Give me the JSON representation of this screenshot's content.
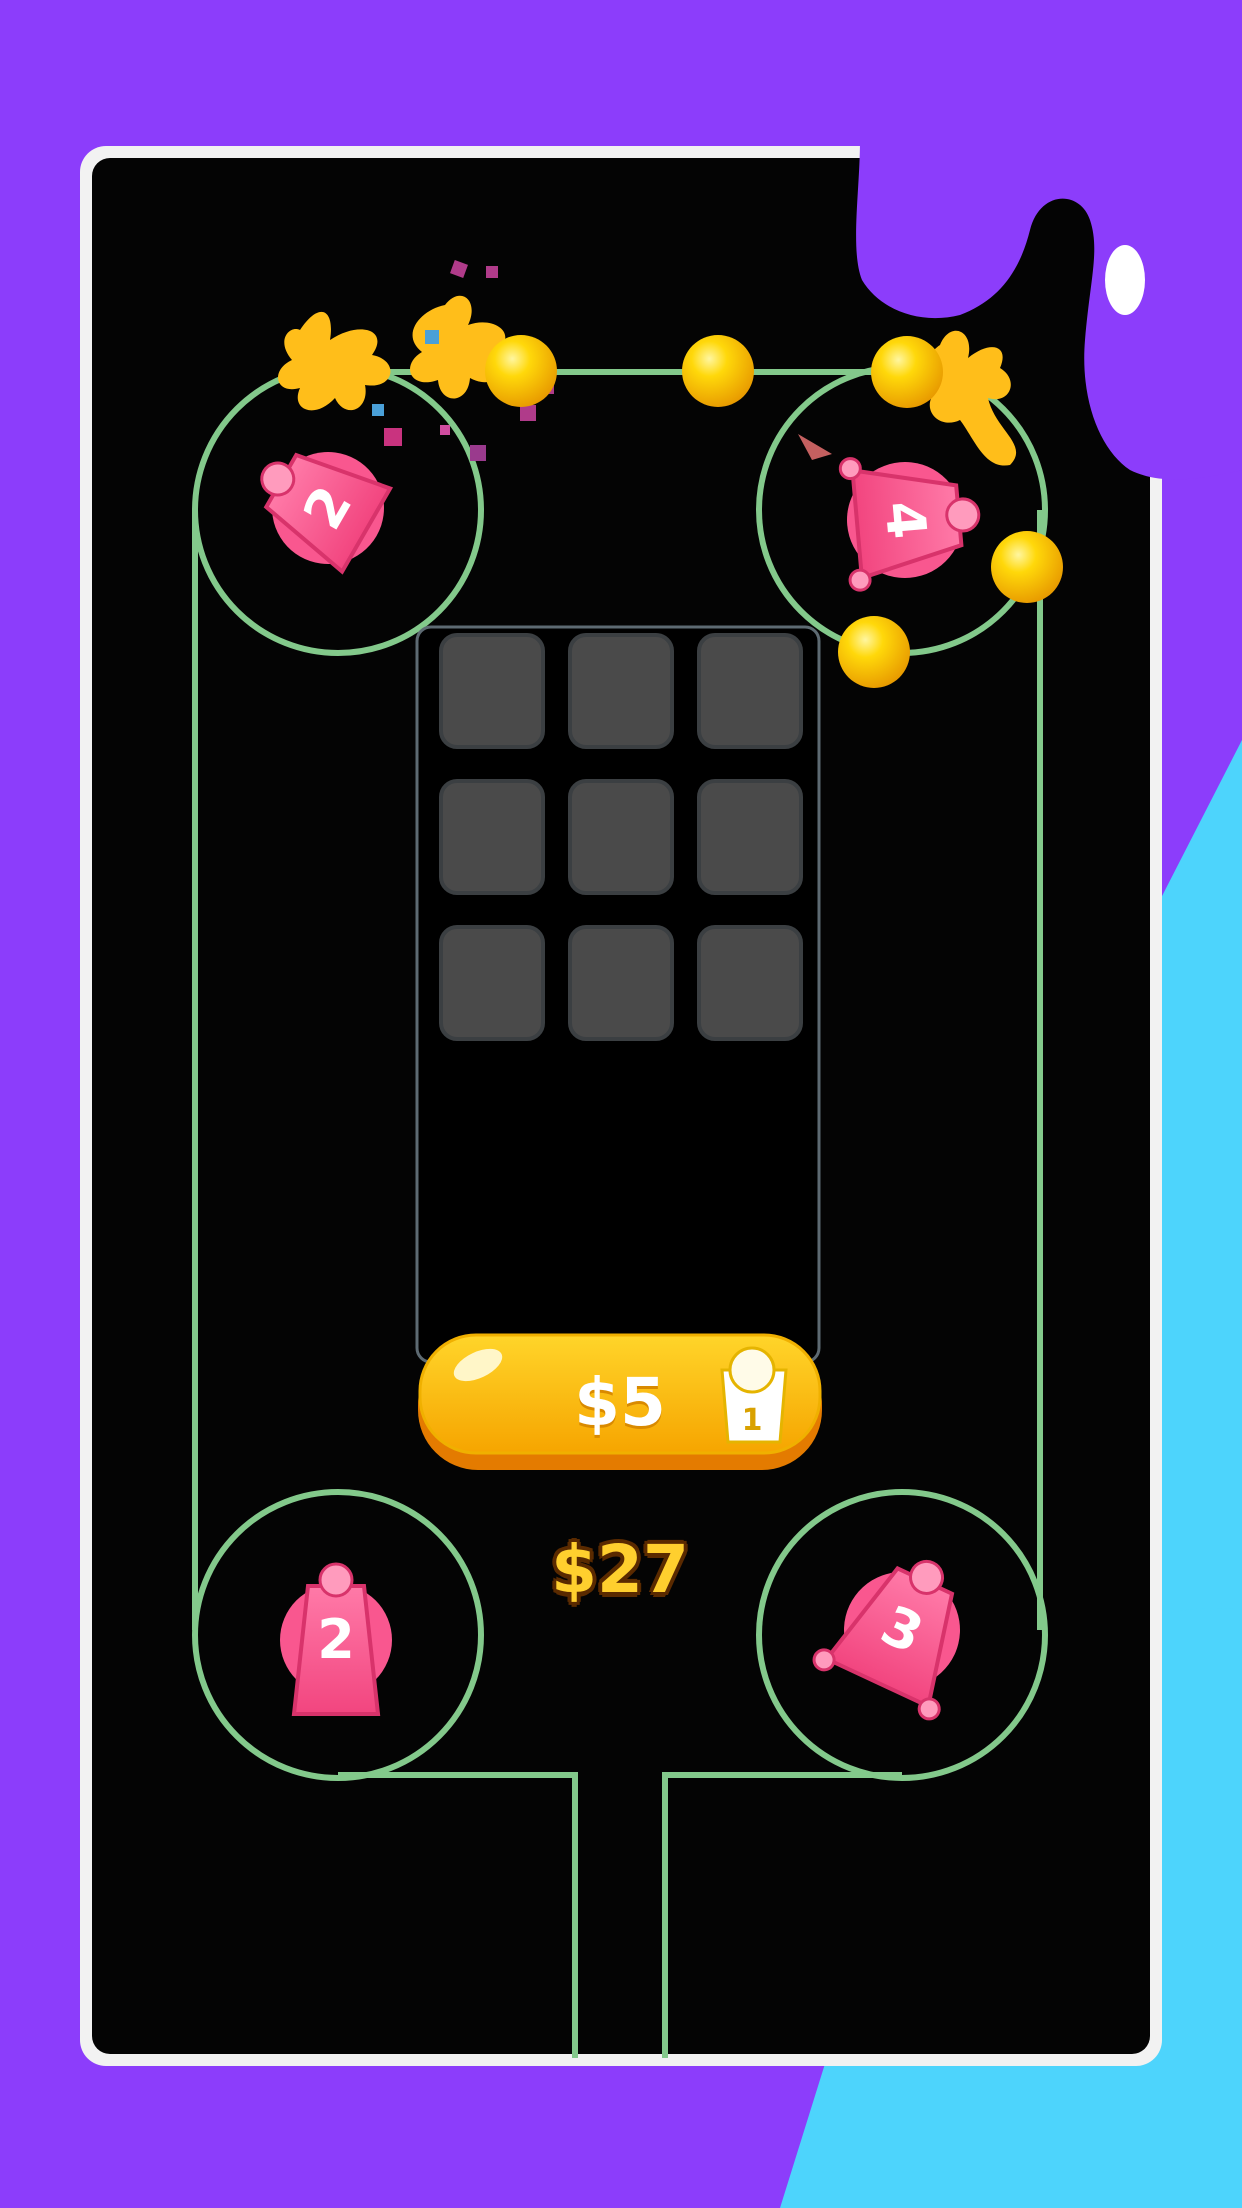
{
  "board": {
    "grid_rows": 3,
    "grid_cols": 3,
    "occupied_slots": 0
  },
  "spawn_button": {
    "price_label": "$5",
    "level": "1"
  },
  "money": {
    "label": "$27"
  },
  "units": [
    {
      "position": "top-left",
      "level": "2"
    },
    {
      "position": "top-right",
      "level": "4"
    },
    {
      "position": "bottom-left",
      "level": "2"
    },
    {
      "position": "bottom-right",
      "level": "3"
    }
  ],
  "colors": {
    "background_purple": "#8c3dfb",
    "splash_blue": "#4dd4fc",
    "track_green": "#83c98b",
    "board_black": "#040404",
    "slot_gray": "#4a4a4a",
    "unit_pink": "#f9578f",
    "button_yellow": "#ffc20e",
    "ball_yellow": "#ffd20a"
  }
}
